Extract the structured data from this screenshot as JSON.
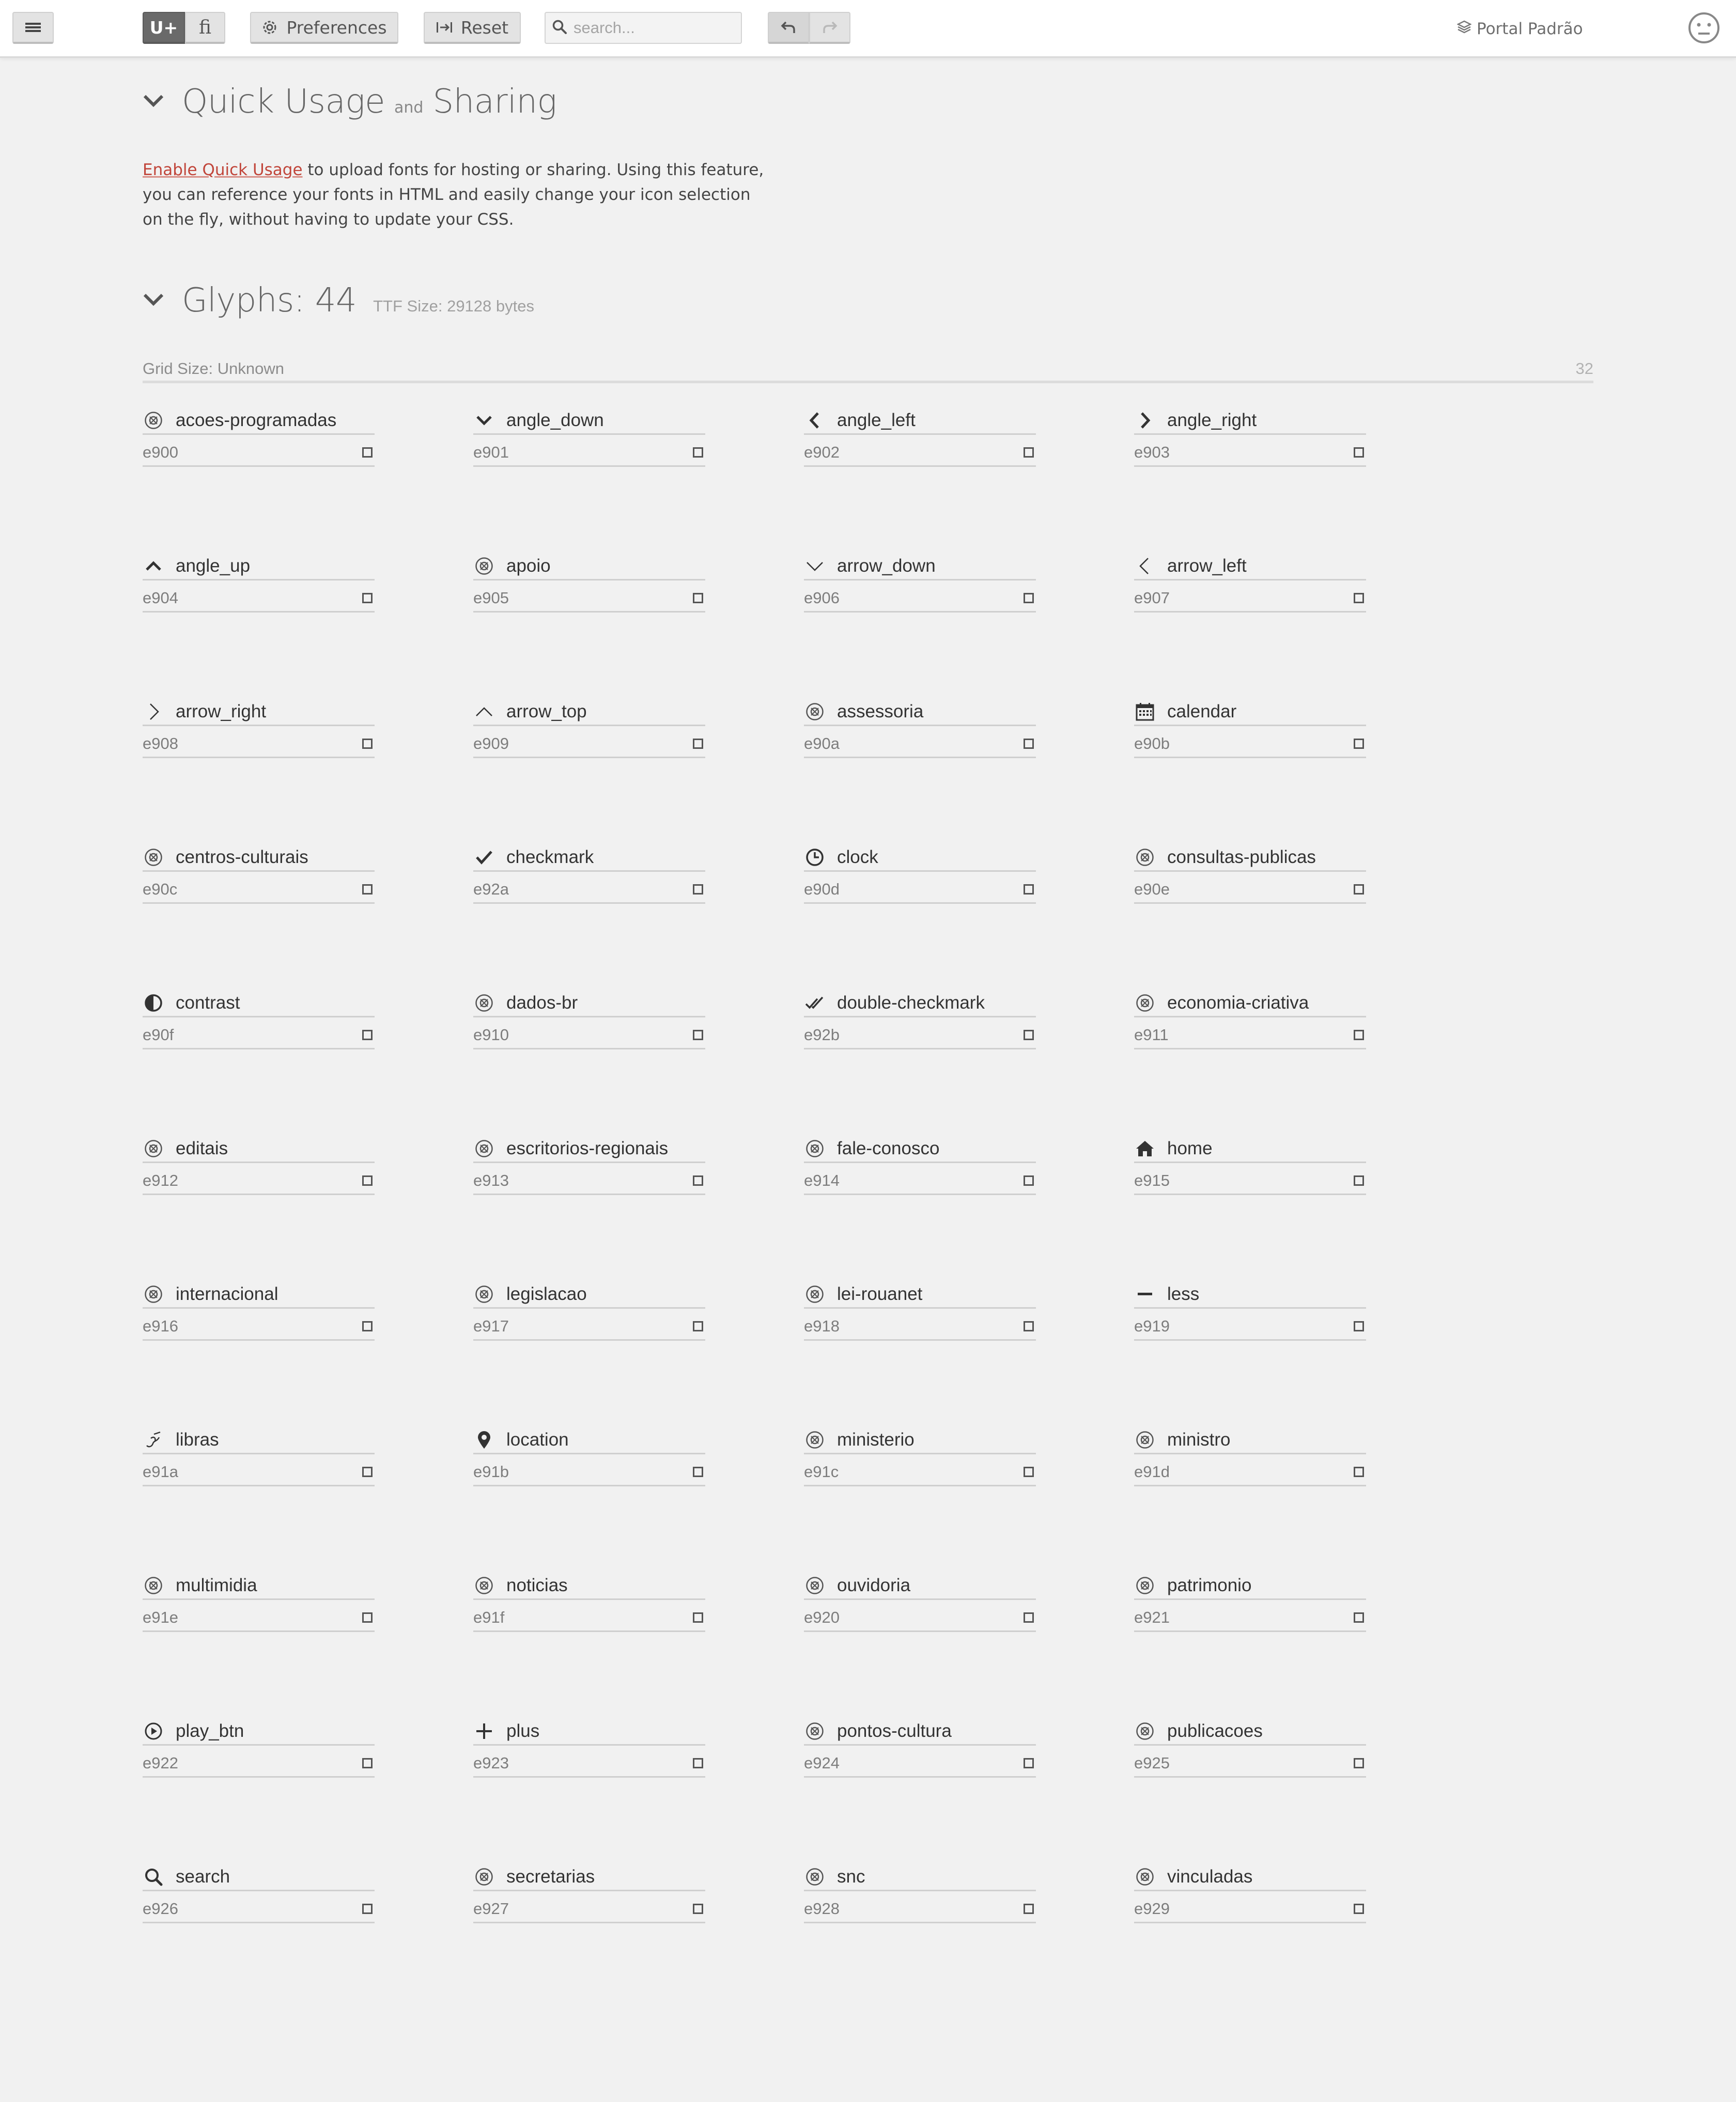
{
  "toolbar": {
    "menu_icon": "hamburger-icon",
    "unicode_label": "U+",
    "ligature_label": "ﬁ",
    "preferences_label": "Preferences",
    "reset_label": "Reset",
    "search_placeholder": "search...",
    "undo_icon": "undo-icon",
    "redo_icon": "redo-icon",
    "project_name": "Portal Padrão",
    "avatar_icon": "face-icon"
  },
  "quick_usage": {
    "title": "Quick Usage",
    "and": "and",
    "title2": "Sharing",
    "link_text": "Enable Quick Usage",
    "line1": " to upload fonts for hosting or sharing. Using this feature,",
    "line2": "you can reference your fonts in HTML and easily change your icon selection",
    "line3": "on the fly, without having to update your CSS."
  },
  "glyphs_section": {
    "title": "Glyphs: 44",
    "ttf_size": "TTF Size: 29128 bytes",
    "grid_size": "Grid Size: Unknown",
    "grid_number": "32"
  },
  "glyphs": [
    {
      "name": "acoes-programadas",
      "code": "e900",
      "icon": "circle-logo"
    },
    {
      "name": "angle_down",
      "code": "e901",
      "icon": "angle-down"
    },
    {
      "name": "angle_left",
      "code": "e902",
      "icon": "angle-left"
    },
    {
      "name": "angle_right",
      "code": "e903",
      "icon": "angle-right"
    },
    {
      "name": "angle_up",
      "code": "e904",
      "icon": "angle-up"
    },
    {
      "name": "apoio",
      "code": "e905",
      "icon": "circle-logo"
    },
    {
      "name": "arrow_down",
      "code": "e906",
      "icon": "arrow-down"
    },
    {
      "name": "arrow_left",
      "code": "e907",
      "icon": "arrow-left"
    },
    {
      "name": "arrow_right",
      "code": "e908",
      "icon": "arrow-right"
    },
    {
      "name": "arrow_top",
      "code": "e909",
      "icon": "arrow-top"
    },
    {
      "name": "assessoria",
      "code": "e90a",
      "icon": "circle-logo"
    },
    {
      "name": "calendar",
      "code": "e90b",
      "icon": "calendar"
    },
    {
      "name": "centros-culturais",
      "code": "e90c",
      "icon": "circle-logo"
    },
    {
      "name": "checkmark",
      "code": "e92a",
      "icon": "checkmark"
    },
    {
      "name": "clock",
      "code": "e90d",
      "icon": "clock"
    },
    {
      "name": "consultas-publicas",
      "code": "e90e",
      "icon": "circle-logo"
    },
    {
      "name": "contrast",
      "code": "e90f",
      "icon": "contrast"
    },
    {
      "name": "dados-br",
      "code": "e910",
      "icon": "circle-logo"
    },
    {
      "name": "double-checkmark",
      "code": "e92b",
      "icon": "double-checkmark"
    },
    {
      "name": "economia-criativa",
      "code": "e911",
      "icon": "circle-logo"
    },
    {
      "name": "editais",
      "code": "e912",
      "icon": "circle-logo"
    },
    {
      "name": "escritorios-regionais",
      "code": "e913",
      "icon": "circle-logo"
    },
    {
      "name": "fale-conosco",
      "code": "e914",
      "icon": "circle-logo"
    },
    {
      "name": "home",
      "code": "e915",
      "icon": "home"
    },
    {
      "name": "internacional",
      "code": "e916",
      "icon": "circle-logo"
    },
    {
      "name": "legislacao",
      "code": "e917",
      "icon": "circle-logo"
    },
    {
      "name": "lei-rouanet",
      "code": "e918",
      "icon": "circle-logo"
    },
    {
      "name": "less",
      "code": "e919",
      "icon": "less"
    },
    {
      "name": "libras",
      "code": "e91a",
      "icon": "libras"
    },
    {
      "name": "location",
      "code": "e91b",
      "icon": "location"
    },
    {
      "name": "ministerio",
      "code": "e91c",
      "icon": "circle-logo"
    },
    {
      "name": "ministro",
      "code": "e91d",
      "icon": "circle-logo"
    },
    {
      "name": "multimidia",
      "code": "e91e",
      "icon": "circle-logo"
    },
    {
      "name": "noticias",
      "code": "e91f",
      "icon": "circle-logo"
    },
    {
      "name": "ouvidoria",
      "code": "e920",
      "icon": "circle-logo"
    },
    {
      "name": "patrimonio",
      "code": "e921",
      "icon": "circle-logo"
    },
    {
      "name": "play_btn",
      "code": "e922",
      "icon": "play"
    },
    {
      "name": "plus",
      "code": "e923",
      "icon": "plus"
    },
    {
      "name": "pontos-cultura",
      "code": "e924",
      "icon": "circle-logo"
    },
    {
      "name": "publicacoes",
      "code": "e925",
      "icon": "circle-logo"
    },
    {
      "name": "search",
      "code": "e926",
      "icon": "search"
    },
    {
      "name": "secretarias",
      "code": "e927",
      "icon": "circle-logo"
    },
    {
      "name": "snc",
      "code": "e928",
      "icon": "circle-logo"
    },
    {
      "name": "vinculadas",
      "code": "e929",
      "icon": "circle-logo"
    }
  ]
}
